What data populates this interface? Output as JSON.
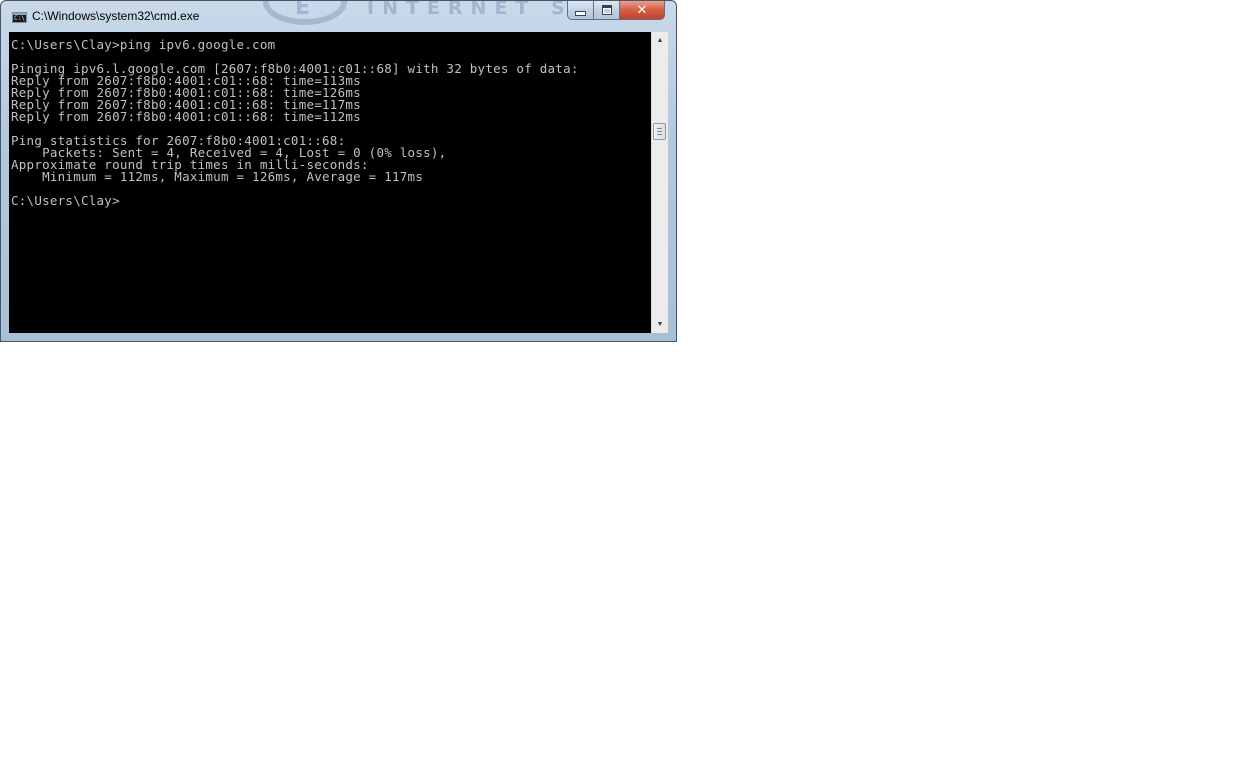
{
  "window": {
    "title": "C:\\Windows\\system32\\cmd.exe",
    "icon": "cmd-icon",
    "icon_text": "C:\\",
    "watermark_letter": "E",
    "watermark_text": "INTERNET SE",
    "buttons": {
      "minimize": "minimize-icon",
      "maximize": "maximize-icon",
      "close_glyph": "✕"
    }
  },
  "console": {
    "colors": {
      "background": "#000000",
      "text": "#c0c0c0"
    },
    "lines": [
      "C:\\Users\\Clay>ping ipv6.google.com",
      "",
      "Pinging ipv6.l.google.com [2607:f8b0:4001:c01::68] with 32 bytes of data:",
      "Reply from 2607:f8b0:4001:c01::68: time=113ms",
      "Reply from 2607:f8b0:4001:c01::68: time=126ms",
      "Reply from 2607:f8b0:4001:c01::68: time=117ms",
      "Reply from 2607:f8b0:4001:c01::68: time=112ms",
      "",
      "Ping statistics for 2607:f8b0:4001:c01::68:",
      "    Packets: Sent = 4, Received = 4, Lost = 0 (0% loss),",
      "Approximate round trip times in milli-seconds:",
      "    Minimum = 112ms, Maximum = 126ms, Average = 117ms",
      "",
      "C:\\Users\\Clay>"
    ]
  },
  "scrollbar": {
    "up_arrow": "▲",
    "down_arrow": "▼"
  }
}
